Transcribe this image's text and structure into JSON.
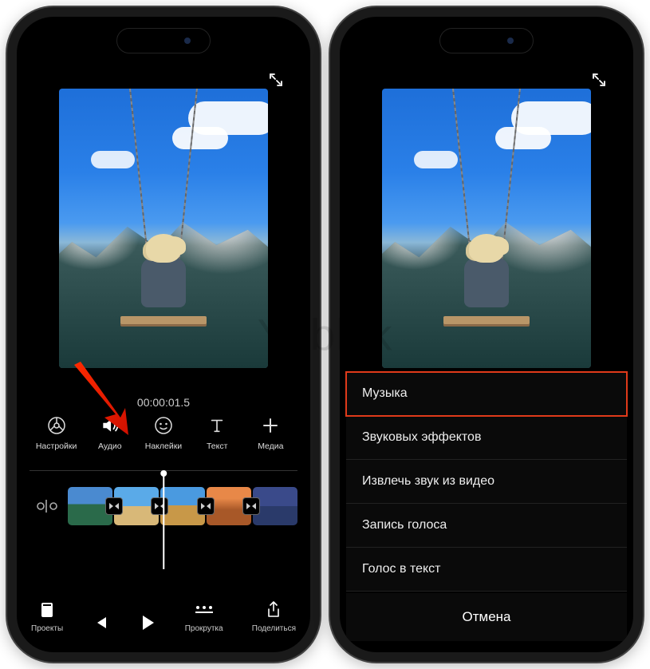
{
  "watermark": "Yablyk",
  "timestamp": "00:00:01.5",
  "toolbar": {
    "settings": "Настройки",
    "audio": "Аудио",
    "stickers": "Наклейки",
    "text": "Текст",
    "media": "Медиа"
  },
  "bottombar": {
    "projects": "Проекты",
    "scroll": "Прокрутка",
    "share": "Поделиться"
  },
  "menu": {
    "music": "Музыка",
    "soundfx": "Звуковых эффектов",
    "extract": "Извлечь звук из видео",
    "voice": "Запись голоса",
    "voicetext": "Голос в текст",
    "cancel": "Отмена"
  }
}
